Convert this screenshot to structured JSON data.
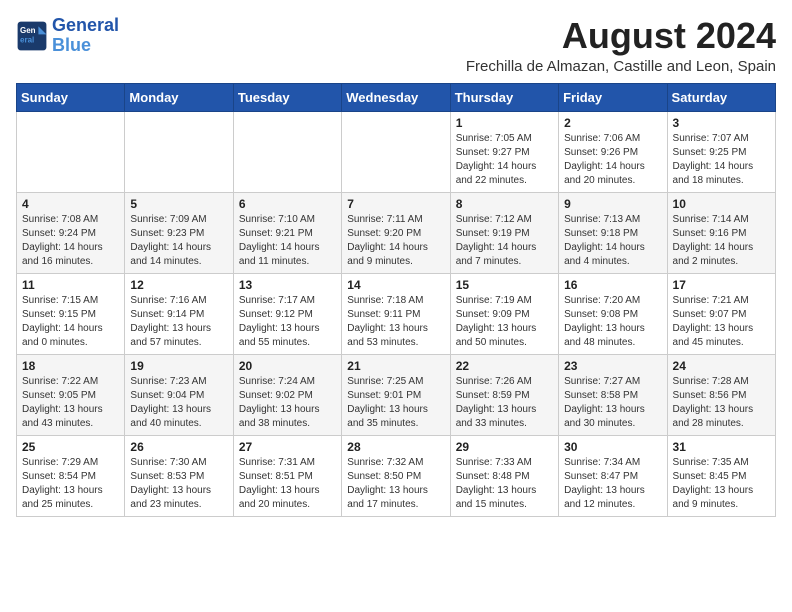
{
  "header": {
    "logo_line1": "General",
    "logo_line2": "Blue",
    "month_year": "August 2024",
    "location": "Frechilla de Almazan, Castille and Leon, Spain"
  },
  "weekdays": [
    "Sunday",
    "Monday",
    "Tuesday",
    "Wednesday",
    "Thursday",
    "Friday",
    "Saturday"
  ],
  "weeks": [
    [
      {
        "day": "",
        "info": ""
      },
      {
        "day": "",
        "info": ""
      },
      {
        "day": "",
        "info": ""
      },
      {
        "day": "",
        "info": ""
      },
      {
        "day": "1",
        "info": "Sunrise: 7:05 AM\nSunset: 9:27 PM\nDaylight: 14 hours\nand 22 minutes."
      },
      {
        "day": "2",
        "info": "Sunrise: 7:06 AM\nSunset: 9:26 PM\nDaylight: 14 hours\nand 20 minutes."
      },
      {
        "day": "3",
        "info": "Sunrise: 7:07 AM\nSunset: 9:25 PM\nDaylight: 14 hours\nand 18 minutes."
      }
    ],
    [
      {
        "day": "4",
        "info": "Sunrise: 7:08 AM\nSunset: 9:24 PM\nDaylight: 14 hours\nand 16 minutes."
      },
      {
        "day": "5",
        "info": "Sunrise: 7:09 AM\nSunset: 9:23 PM\nDaylight: 14 hours\nand 14 minutes."
      },
      {
        "day": "6",
        "info": "Sunrise: 7:10 AM\nSunset: 9:21 PM\nDaylight: 14 hours\nand 11 minutes."
      },
      {
        "day": "7",
        "info": "Sunrise: 7:11 AM\nSunset: 9:20 PM\nDaylight: 14 hours\nand 9 minutes."
      },
      {
        "day": "8",
        "info": "Sunrise: 7:12 AM\nSunset: 9:19 PM\nDaylight: 14 hours\nand 7 minutes."
      },
      {
        "day": "9",
        "info": "Sunrise: 7:13 AM\nSunset: 9:18 PM\nDaylight: 14 hours\nand 4 minutes."
      },
      {
        "day": "10",
        "info": "Sunrise: 7:14 AM\nSunset: 9:16 PM\nDaylight: 14 hours\nand 2 minutes."
      }
    ],
    [
      {
        "day": "11",
        "info": "Sunrise: 7:15 AM\nSunset: 9:15 PM\nDaylight: 14 hours\nand 0 minutes."
      },
      {
        "day": "12",
        "info": "Sunrise: 7:16 AM\nSunset: 9:14 PM\nDaylight: 13 hours\nand 57 minutes."
      },
      {
        "day": "13",
        "info": "Sunrise: 7:17 AM\nSunset: 9:12 PM\nDaylight: 13 hours\nand 55 minutes."
      },
      {
        "day": "14",
        "info": "Sunrise: 7:18 AM\nSunset: 9:11 PM\nDaylight: 13 hours\nand 53 minutes."
      },
      {
        "day": "15",
        "info": "Sunrise: 7:19 AM\nSunset: 9:09 PM\nDaylight: 13 hours\nand 50 minutes."
      },
      {
        "day": "16",
        "info": "Sunrise: 7:20 AM\nSunset: 9:08 PM\nDaylight: 13 hours\nand 48 minutes."
      },
      {
        "day": "17",
        "info": "Sunrise: 7:21 AM\nSunset: 9:07 PM\nDaylight: 13 hours\nand 45 minutes."
      }
    ],
    [
      {
        "day": "18",
        "info": "Sunrise: 7:22 AM\nSunset: 9:05 PM\nDaylight: 13 hours\nand 43 minutes."
      },
      {
        "day": "19",
        "info": "Sunrise: 7:23 AM\nSunset: 9:04 PM\nDaylight: 13 hours\nand 40 minutes."
      },
      {
        "day": "20",
        "info": "Sunrise: 7:24 AM\nSunset: 9:02 PM\nDaylight: 13 hours\nand 38 minutes."
      },
      {
        "day": "21",
        "info": "Sunrise: 7:25 AM\nSunset: 9:01 PM\nDaylight: 13 hours\nand 35 minutes."
      },
      {
        "day": "22",
        "info": "Sunrise: 7:26 AM\nSunset: 8:59 PM\nDaylight: 13 hours\nand 33 minutes."
      },
      {
        "day": "23",
        "info": "Sunrise: 7:27 AM\nSunset: 8:58 PM\nDaylight: 13 hours\nand 30 minutes."
      },
      {
        "day": "24",
        "info": "Sunrise: 7:28 AM\nSunset: 8:56 PM\nDaylight: 13 hours\nand 28 minutes."
      }
    ],
    [
      {
        "day": "25",
        "info": "Sunrise: 7:29 AM\nSunset: 8:54 PM\nDaylight: 13 hours\nand 25 minutes."
      },
      {
        "day": "26",
        "info": "Sunrise: 7:30 AM\nSunset: 8:53 PM\nDaylight: 13 hours\nand 23 minutes."
      },
      {
        "day": "27",
        "info": "Sunrise: 7:31 AM\nSunset: 8:51 PM\nDaylight: 13 hours\nand 20 minutes."
      },
      {
        "day": "28",
        "info": "Sunrise: 7:32 AM\nSunset: 8:50 PM\nDaylight: 13 hours\nand 17 minutes."
      },
      {
        "day": "29",
        "info": "Sunrise: 7:33 AM\nSunset: 8:48 PM\nDaylight: 13 hours\nand 15 minutes."
      },
      {
        "day": "30",
        "info": "Sunrise: 7:34 AM\nSunset: 8:47 PM\nDaylight: 13 hours\nand 12 minutes."
      },
      {
        "day": "31",
        "info": "Sunrise: 7:35 AM\nSunset: 8:45 PM\nDaylight: 13 hours\nand 9 minutes."
      }
    ]
  ]
}
